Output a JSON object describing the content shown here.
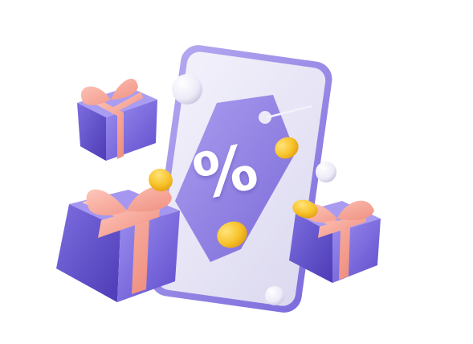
{
  "illustration": {
    "tag_symbol": "%",
    "objects": [
      "smartphone",
      "discount-tag",
      "gift-box",
      "gift-box",
      "gift-box",
      "gold-coin",
      "gold-coin",
      "gold-coin",
      "gold-coin",
      "pearl",
      "pearl",
      "pearl"
    ]
  },
  "colors": {
    "phone_frame": "#9a8ce6",
    "phone_screen": "#e8e6f6",
    "tag": "#8a78e0",
    "gift_box": "#7a6ae0",
    "ribbon": "#f4a99a",
    "coin": "#f6c02c",
    "pearl": "#f2f2f8",
    "background": "#ffffff"
  }
}
